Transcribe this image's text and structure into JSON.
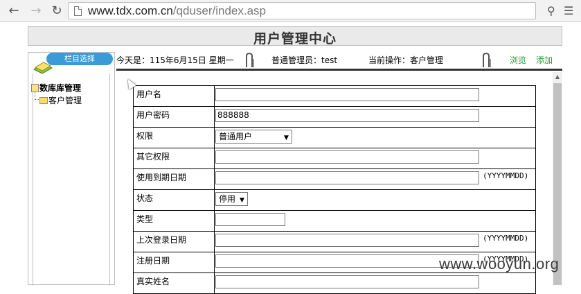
{
  "browser": {
    "url_domain": "www.tdx.com.cn",
    "url_path": "/qduser/index.asp"
  },
  "header": {
    "title": "用户管理中心"
  },
  "sidebar": {
    "badge": "栏目选择",
    "root": "数库库管理",
    "child": "客户管理"
  },
  "info_bar": {
    "date": "今天是：115年6月15日 星期一",
    "admin": "普通管理员：test",
    "operation": "当前操作：客户管理",
    "browse": "浏览",
    "add": "添加"
  },
  "form": {
    "rows": [
      {
        "label": "用户名",
        "value": ""
      },
      {
        "label": "用户密码",
        "value": "888888"
      },
      {
        "label": "权限",
        "select": "普通用户"
      },
      {
        "label": "其它权限",
        "value": ""
      },
      {
        "label": "使用到期日期",
        "value": "",
        "hint": "(YYYYMMDD)"
      },
      {
        "label": "状态",
        "select": "停用"
      },
      {
        "label": "类型",
        "value": ""
      },
      {
        "label": "上次登录日期",
        "value": "",
        "hint": "(YYYYMMDD)"
      },
      {
        "label": "注册日期",
        "value": "",
        "hint": "(YYYYMMDD)"
      },
      {
        "label": "真实姓名",
        "value": ""
      }
    ]
  },
  "watermark": "www.wooyun.org",
  "colors": {
    "link_green": "#2c9c3a",
    "badge_blue": "#3a9bd6"
  }
}
